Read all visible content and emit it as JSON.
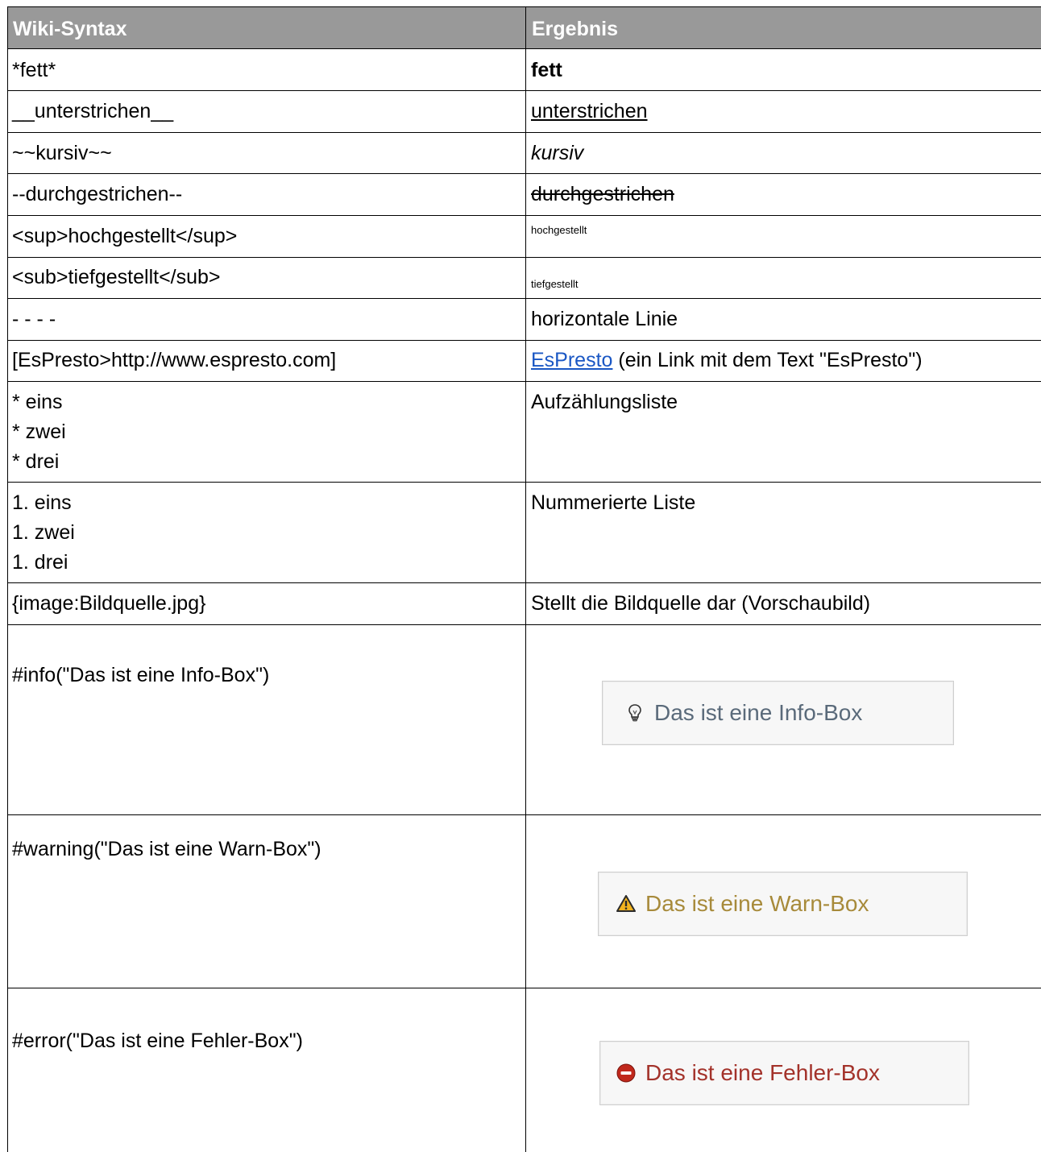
{
  "header": {
    "col1": "Wiki-Syntax",
    "col2": "Ergebnis"
  },
  "rows": [
    {
      "syntax": "*fett*",
      "result": "fett"
    },
    {
      "syntax": "__unterstrichen__",
      "result": "unterstrichen"
    },
    {
      "syntax": "~~kursiv~~",
      "result": "kursiv"
    },
    {
      "syntax": "--durchgestrichen--",
      "result": "durchgestrichen"
    },
    {
      "syntax": "<sup>hochgestellt</sup>",
      "result": "hochgestellt"
    },
    {
      "syntax": "<sub>tiefgestellt</sub>",
      "result": "tiefgestellt"
    },
    {
      "syntax": "- - - -",
      "result": "horizontale Linie"
    },
    {
      "syntax": "[EsPresto>http://www.espresto.com]",
      "result_link": "EsPresto",
      "result": " (ein Link mit dem Text \"EsPresto\")"
    },
    {
      "syntax": "* eins\n* zwei\n* drei",
      "result": "Aufzählungsliste"
    },
    {
      "syntax": "1. eins\n1. zwei\n1. drei",
      "result": "Nummerierte Liste"
    },
    {
      "syntax": "{image:Bildquelle.jpg}",
      "result": "Stellt die Bildquelle dar (Vorschaubild)"
    },
    {
      "syntax": "#info(\"Das ist eine Info-Box\")",
      "result": "Das ist eine Info-Box"
    },
    {
      "syntax": "#warning(\"Das ist eine Warn-Box\")",
      "result": "Das ist eine Warn-Box"
    },
    {
      "syntax": "#error(\"Das ist eine Fehler-Box\")",
      "result": "Das ist eine Fehler-Box"
    }
  ],
  "icons": {
    "info": "lightbulb-icon",
    "warning": "warning-icon",
    "error": "error-icon"
  },
  "colors": {
    "header_bg": "#999999",
    "link": "#1a57c4"
  }
}
